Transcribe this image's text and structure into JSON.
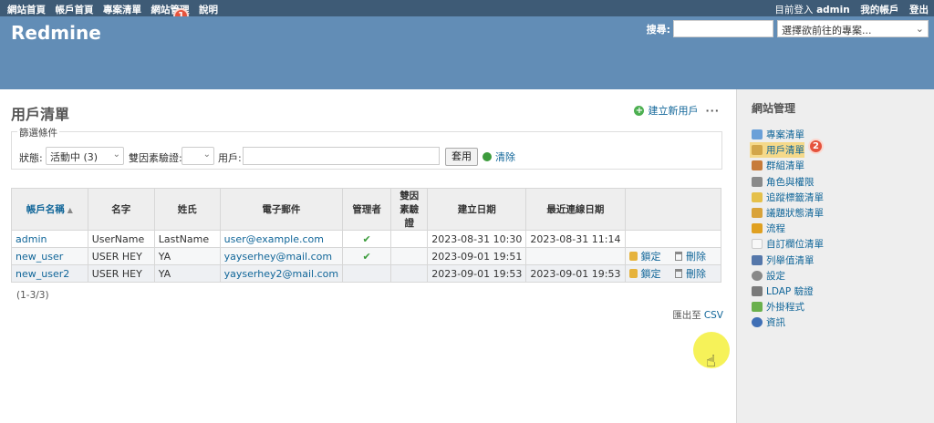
{
  "top_menu": {
    "left": [
      "網站首頁",
      "帳戶首頁",
      "專案清單",
      "網站管理",
      "說明"
    ],
    "logged_in_prefix": "目前登入",
    "logged_in_user": "admin",
    "my_account": "我的帳戶",
    "logout": "登出"
  },
  "markers": {
    "one": "1",
    "two": "2"
  },
  "header": {
    "title": "Redmine",
    "search_label": "搜尋:",
    "project_jump": "選擇欲前往的專案..."
  },
  "page": {
    "title": "用戶清單",
    "new_user": "建立新用戶",
    "more": "···"
  },
  "filters": {
    "legend": "篩選條件",
    "status_label": "狀態:",
    "status_value": "活動中 (3)",
    "twofa_label": "雙因素驗證:",
    "twofa_value": "",
    "user_label": "用戶:",
    "apply": "套用",
    "clear": "清除"
  },
  "table": {
    "headers": [
      "帳戶名稱",
      "名字",
      "姓氏",
      "電子郵件",
      "管理者",
      "雙因素驗證",
      "建立日期",
      "最近連線日期",
      ""
    ],
    "rows": [
      {
        "login": "admin",
        "first": "UserName",
        "last": "LastName",
        "email": "user@example.com",
        "admin": "✔",
        "twofa": "",
        "created": "2023-08-31 10:30",
        "last_login": "2023-08-31 11:14",
        "lock": "",
        "delete": ""
      },
      {
        "login": "new_user",
        "first": "USER HEY",
        "last": "YA",
        "email": "yayserhey@mail.com",
        "admin": "✔",
        "twofa": "",
        "created": "2023-09-01 19:51",
        "last_login": "",
        "lock": "鎖定",
        "delete": "刪除"
      },
      {
        "login": "new_user2",
        "first": "USER HEY",
        "last": "YA",
        "email": "yayserhey2@mail.com",
        "admin": "",
        "twofa": "",
        "created": "2023-09-01 19:53",
        "last_login": "2023-09-01 19:53",
        "lock": "鎖定",
        "delete": "刪除"
      }
    ]
  },
  "pagination": "(1-3/3)",
  "export": {
    "label": "匯出至",
    "csv": "CSV"
  },
  "sidebar": {
    "title": "網站管理",
    "items": [
      {
        "label": "專案清單",
        "icon": "projects-icon",
        "color": "#6aa0d8"
      },
      {
        "label": "用戶清單",
        "icon": "user-icon",
        "color": "#d2a64a"
      },
      {
        "label": "群組清單",
        "icon": "group-icon",
        "color": "#c77b3a"
      },
      {
        "label": "角色與權限",
        "icon": "roles-icon",
        "color": "#8a8a8a"
      },
      {
        "label": "追蹤標籤清單",
        "icon": "trackers-icon",
        "color": "#e5c04a"
      },
      {
        "label": "議題狀態清單",
        "icon": "issue-status-icon",
        "color": "#d9a33a"
      },
      {
        "label": "流程",
        "icon": "workflow-icon",
        "color": "#e0a020"
      },
      {
        "label": "自訂欄位清單",
        "icon": "custom-fields-icon",
        "color": "#f0f0f0"
      },
      {
        "label": "列舉值清單",
        "icon": "list-icon",
        "color": "#5577aa"
      },
      {
        "label": "設定",
        "icon": "gear-icon",
        "color": "#888888"
      },
      {
        "label": "LDAP 驗證",
        "icon": "ldap-icon",
        "color": "#7a7a7a"
      },
      {
        "label": "外掛程式",
        "icon": "plugin-icon",
        "color": "#6ab04c"
      },
      {
        "label": "資訊",
        "icon": "info-icon",
        "color": "#3f6fb5"
      }
    ]
  }
}
